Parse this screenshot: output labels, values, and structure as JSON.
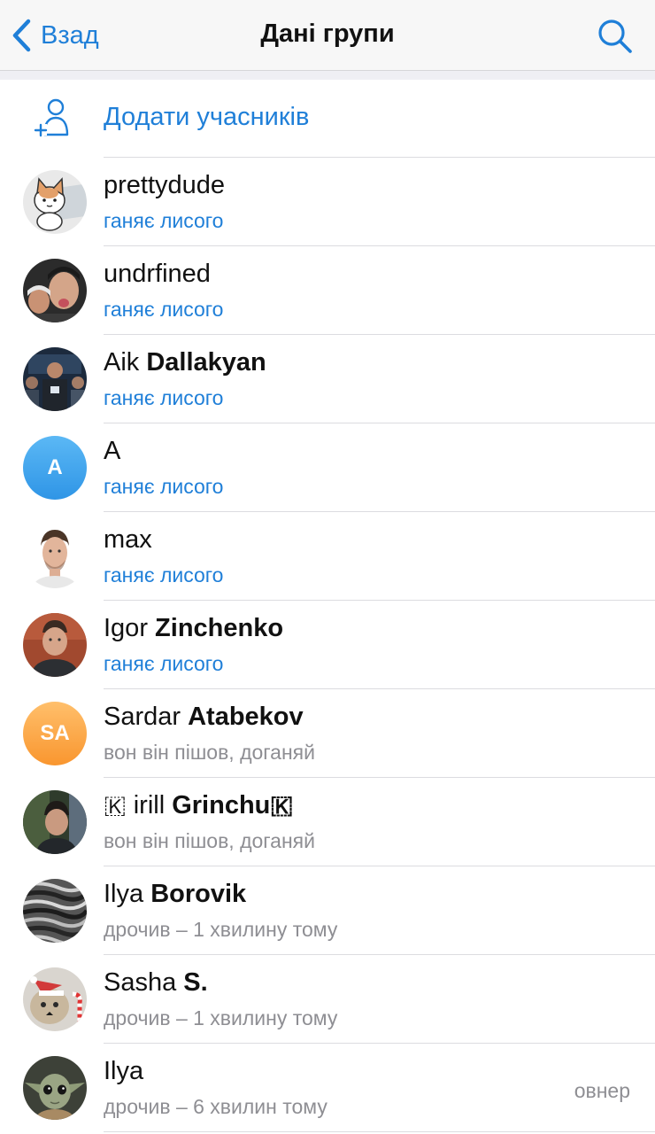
{
  "nav": {
    "back_label": "Взад",
    "title": "Дані групи"
  },
  "add_members_label": "Додати учасників",
  "colors": {
    "accent": "#1f7fd8",
    "secondary_text": "#8e8e93"
  },
  "members": [
    {
      "first": "prettydude",
      "last": "",
      "status": "ганяє лисого",
      "online": true,
      "avatar": "cat-sticker-photo"
    },
    {
      "first": "undrfined",
      "last": "",
      "status": "ганяє лисого",
      "online": true,
      "avatar": "selfie-photo"
    },
    {
      "first": "Aik",
      "last": "Dallakyan",
      "status": "ганяє лисого",
      "online": true,
      "avatar": "event-photo"
    },
    {
      "first": "A",
      "last": "",
      "status": "ганяє лисого",
      "online": true,
      "avatar": "initials",
      "initials": "A",
      "avatar_color": "#3ea6ef"
    },
    {
      "first": "max",
      "last": "",
      "status": "ганяє лисого",
      "online": true,
      "avatar": "portrait-photo"
    },
    {
      "first": "Igor",
      "last": "Zinchenko",
      "status": "ганяє лисого",
      "online": true,
      "avatar": "portrait-photo"
    },
    {
      "first": "Sardar",
      "last": "Atabekov",
      "status": "вон він пішов, доганяй",
      "online": false,
      "avatar": "initials",
      "initials": "SA",
      "avatar_color": "#fdaa4f"
    },
    {
      "first": "🇰 irill",
      "last": "Grinchu🇰",
      "status": "вон він пішов, доганяй",
      "online": false,
      "avatar": "portrait-photo"
    },
    {
      "first": "Ilya",
      "last": "Borovik",
      "status": "дрочив – 1 хвилину тому",
      "online": false,
      "avatar": "texture-photo"
    },
    {
      "first": "Sasha",
      "last": "S.",
      "status": "дрочив – 1 хвилину тому",
      "online": false,
      "avatar": "christmas-cat-photo"
    },
    {
      "first": "Ilya",
      "last": "",
      "status": "дрочив – 6 хвилин тому",
      "online": false,
      "avatar": "baby-yoda-photo",
      "role": "овнер"
    }
  ]
}
